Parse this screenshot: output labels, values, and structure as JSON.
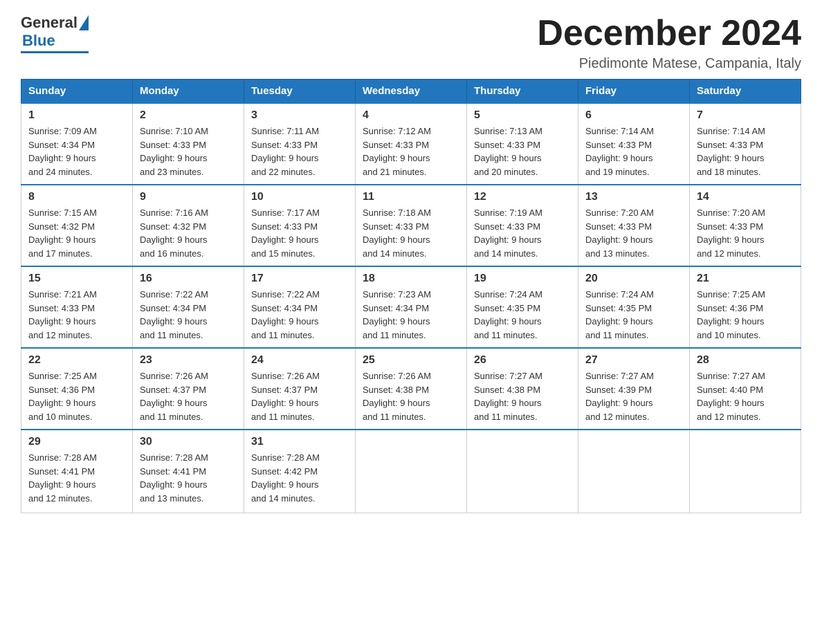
{
  "logo": {
    "general": "General",
    "blue": "Blue"
  },
  "header": {
    "month_year": "December 2024",
    "location": "Piedimonte Matese, Campania, Italy"
  },
  "days_of_week": [
    "Sunday",
    "Monday",
    "Tuesday",
    "Wednesday",
    "Thursday",
    "Friday",
    "Saturday"
  ],
  "weeks": [
    [
      {
        "day": "1",
        "sunrise": "7:09 AM",
        "sunset": "4:34 PM",
        "daylight": "9 hours and 24 minutes."
      },
      {
        "day": "2",
        "sunrise": "7:10 AM",
        "sunset": "4:33 PM",
        "daylight": "9 hours and 23 minutes."
      },
      {
        "day": "3",
        "sunrise": "7:11 AM",
        "sunset": "4:33 PM",
        "daylight": "9 hours and 22 minutes."
      },
      {
        "day": "4",
        "sunrise": "7:12 AM",
        "sunset": "4:33 PM",
        "daylight": "9 hours and 21 minutes."
      },
      {
        "day": "5",
        "sunrise": "7:13 AM",
        "sunset": "4:33 PM",
        "daylight": "9 hours and 20 minutes."
      },
      {
        "day": "6",
        "sunrise": "7:14 AM",
        "sunset": "4:33 PM",
        "daylight": "9 hours and 19 minutes."
      },
      {
        "day": "7",
        "sunrise": "7:14 AM",
        "sunset": "4:33 PM",
        "daylight": "9 hours and 18 minutes."
      }
    ],
    [
      {
        "day": "8",
        "sunrise": "7:15 AM",
        "sunset": "4:32 PM",
        "daylight": "9 hours and 17 minutes."
      },
      {
        "day": "9",
        "sunrise": "7:16 AM",
        "sunset": "4:32 PM",
        "daylight": "9 hours and 16 minutes."
      },
      {
        "day": "10",
        "sunrise": "7:17 AM",
        "sunset": "4:33 PM",
        "daylight": "9 hours and 15 minutes."
      },
      {
        "day": "11",
        "sunrise": "7:18 AM",
        "sunset": "4:33 PM",
        "daylight": "9 hours and 14 minutes."
      },
      {
        "day": "12",
        "sunrise": "7:19 AM",
        "sunset": "4:33 PM",
        "daylight": "9 hours and 14 minutes."
      },
      {
        "day": "13",
        "sunrise": "7:20 AM",
        "sunset": "4:33 PM",
        "daylight": "9 hours and 13 minutes."
      },
      {
        "day": "14",
        "sunrise": "7:20 AM",
        "sunset": "4:33 PM",
        "daylight": "9 hours and 12 minutes."
      }
    ],
    [
      {
        "day": "15",
        "sunrise": "7:21 AM",
        "sunset": "4:33 PM",
        "daylight": "9 hours and 12 minutes."
      },
      {
        "day": "16",
        "sunrise": "7:22 AM",
        "sunset": "4:34 PM",
        "daylight": "9 hours and 11 minutes."
      },
      {
        "day": "17",
        "sunrise": "7:22 AM",
        "sunset": "4:34 PM",
        "daylight": "9 hours and 11 minutes."
      },
      {
        "day": "18",
        "sunrise": "7:23 AM",
        "sunset": "4:34 PM",
        "daylight": "9 hours and 11 minutes."
      },
      {
        "day": "19",
        "sunrise": "7:24 AM",
        "sunset": "4:35 PM",
        "daylight": "9 hours and 11 minutes."
      },
      {
        "day": "20",
        "sunrise": "7:24 AM",
        "sunset": "4:35 PM",
        "daylight": "9 hours and 11 minutes."
      },
      {
        "day": "21",
        "sunrise": "7:25 AM",
        "sunset": "4:36 PM",
        "daylight": "9 hours and 10 minutes."
      }
    ],
    [
      {
        "day": "22",
        "sunrise": "7:25 AM",
        "sunset": "4:36 PM",
        "daylight": "9 hours and 10 minutes."
      },
      {
        "day": "23",
        "sunrise": "7:26 AM",
        "sunset": "4:37 PM",
        "daylight": "9 hours and 11 minutes."
      },
      {
        "day": "24",
        "sunrise": "7:26 AM",
        "sunset": "4:37 PM",
        "daylight": "9 hours and 11 minutes."
      },
      {
        "day": "25",
        "sunrise": "7:26 AM",
        "sunset": "4:38 PM",
        "daylight": "9 hours and 11 minutes."
      },
      {
        "day": "26",
        "sunrise": "7:27 AM",
        "sunset": "4:38 PM",
        "daylight": "9 hours and 11 minutes."
      },
      {
        "day": "27",
        "sunrise": "7:27 AM",
        "sunset": "4:39 PM",
        "daylight": "9 hours and 12 minutes."
      },
      {
        "day": "28",
        "sunrise": "7:27 AM",
        "sunset": "4:40 PM",
        "daylight": "9 hours and 12 minutes."
      }
    ],
    [
      {
        "day": "29",
        "sunrise": "7:28 AM",
        "sunset": "4:41 PM",
        "daylight": "9 hours and 12 minutes."
      },
      {
        "day": "30",
        "sunrise": "7:28 AM",
        "sunset": "4:41 PM",
        "daylight": "9 hours and 13 minutes."
      },
      {
        "day": "31",
        "sunrise": "7:28 AM",
        "sunset": "4:42 PM",
        "daylight": "9 hours and 14 minutes."
      },
      null,
      null,
      null,
      null
    ]
  ],
  "labels": {
    "sunrise": "Sunrise:",
    "sunset": "Sunset:",
    "daylight": "Daylight:"
  }
}
